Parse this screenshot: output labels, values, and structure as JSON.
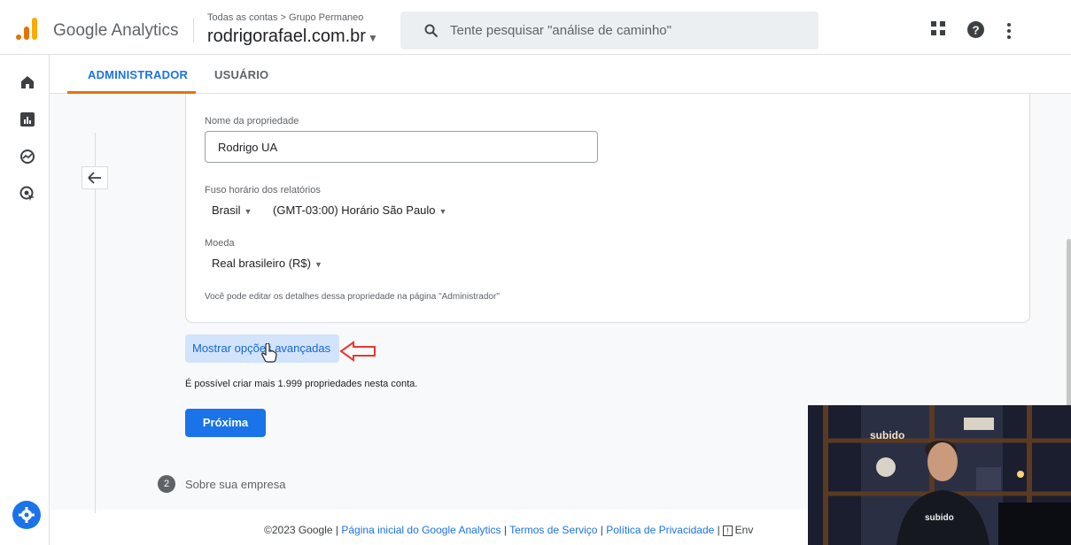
{
  "header": {
    "product_name": "Google Analytics",
    "breadcrumb": "Todas as contas > Grupo Permaneo",
    "account_name": "rodrigorafael.com.br",
    "search_placeholder": "Tente pesquisar \"análise de caminho\"",
    "icons": [
      "apps-grid-icon",
      "help-icon",
      "more-vert-icon"
    ]
  },
  "leftnav": {
    "items": [
      "home-icon",
      "reports-icon",
      "explore-icon",
      "advertising-icon"
    ],
    "admin": "settings-gear-icon"
  },
  "tabs": [
    {
      "label": "ADMINISTRADOR",
      "active": true
    },
    {
      "label": "USUÁRIO",
      "active": false
    }
  ],
  "form": {
    "property_name_label": "Nome da propriedade",
    "property_name_value": "Rodrigo UA",
    "timezone_label": "Fuso horário dos relatórios",
    "country_value": "Brasil",
    "timezone_value": "(GMT-03:00) Horário São Paulo",
    "currency_label": "Moeda",
    "currency_value": "Real brasileiro (R$)",
    "help_text": "Você pode editar os detalhes dessa propriedade na página \"Administrador\""
  },
  "advanced_button": "Mostrar opções avançadas",
  "properties_note": "É possível criar mais 1.999 propriedades nesta conta.",
  "next_button": "Próxima",
  "step2": {
    "number": "2",
    "title": "Sobre sua empresa"
  },
  "footer": {
    "copyright": "©2023 Google",
    "sep": " | ",
    "link_home": "Página inicial do Google Analytics",
    "link_terms": "Termos de Serviço",
    "link_privacy": "Política de Privacidade",
    "feedback": "Env"
  },
  "webcam": {
    "sign_text": "subido",
    "shirt_text": "subido"
  },
  "colors": {
    "accent": "#1a73e8",
    "tab_underline": "#e8710a",
    "annotation_arrow": "#e53935"
  }
}
